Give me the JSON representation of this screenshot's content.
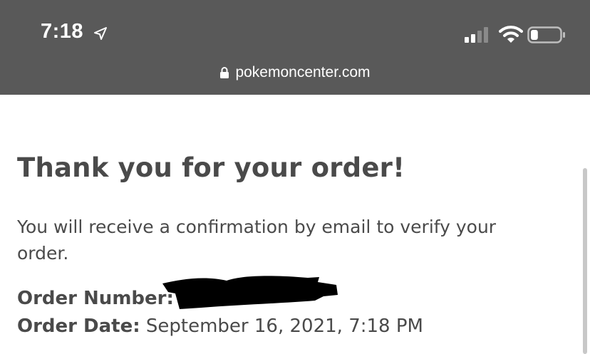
{
  "status_bar": {
    "time": "7:18",
    "icons": [
      "location-arrow-icon",
      "signal-icon",
      "wifi-icon",
      "battery-icon"
    ],
    "battery_level": 0.25
  },
  "address_bar": {
    "url": "pokemoncenter.com",
    "secure_icon": "lock-icon"
  },
  "page": {
    "title": "Thank you for your order!",
    "message": "You will receive a confirmation by email to verify your order.",
    "order_number_label": "Order Number:",
    "order_number_value": "",
    "order_date_label": "Order Date:",
    "order_date_value": "September 16, 2021, 7:18 PM"
  },
  "colors": {
    "status_bar_bg": "#595959",
    "page_bg": "#ffffff",
    "text": "#4a4a4a",
    "redaction": "#000000"
  }
}
